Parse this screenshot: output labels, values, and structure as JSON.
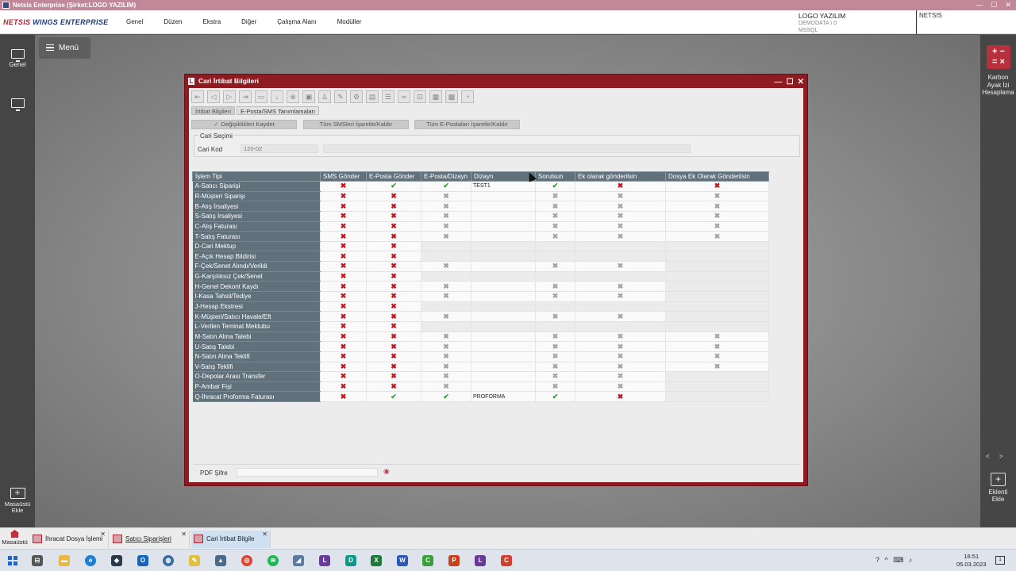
{
  "titlebar": {
    "title": "Netsis Enterprise (Şirket:LOGO YAZILIM)",
    "min": "—",
    "max": "☐",
    "close": "✕"
  },
  "menubar": {
    "logo_prefix": "NETSIS",
    "logo_suffix": " WINGS ENTERPRISE",
    "items": [
      "Genel",
      "Düzen",
      "Ekstra",
      "Diğer",
      "Çalışma Alanı",
      "Modüller"
    ],
    "company": "LOGO YAZILIM",
    "db": "DEMODATA \\ 0",
    "dbtype": "MSSQL",
    "user": "NETSIS"
  },
  "leftbar": {
    "genel_label": "Genel",
    "add_desktop_label_1": "Masaüstü",
    "add_desktop_label_2": "Ekle"
  },
  "menu_button": "Menü",
  "rightbar": {
    "karbon_symbols_top": "+ −",
    "karbon_symbols_bottom": "= ×",
    "karbon_label_1": "Karbon",
    "karbon_label_2": "Ayak İzi",
    "karbon_label_3": "Hesaplama",
    "nav": "< >",
    "eklenti_label_1": "Eklenti",
    "eklenti_label_2": "Ekle"
  },
  "window": {
    "title": "Cari İrtibat Bilgileri",
    "tabs": [
      "İrtibat Bilgileri",
      "E-Posta/SMS Tanımlamaları"
    ],
    "actions": {
      "save": "Değişiklikleri Kaydet",
      "toggle_sms": "Tüm SMSleri İşaretle/Kaldır",
      "toggle_email": "Tüm E-Postaları İşaretle/Kaldır"
    },
    "cari_group_title": "Cari Seçimi",
    "cari_kod_label": "Cari Kod",
    "cari_kod_value": "120-02",
    "pdf_label": "PDF Şifre"
  },
  "table": {
    "columns": [
      "İşlem Tipi",
      "SMS Gönder",
      "E-Posta Gönder",
      "E-Posta/Dizayn",
      "Dizayn",
      "Sorulsun",
      "Ek olarak gönderilsin",
      "Dosya Ek Olarak Gönderilsin"
    ],
    "rows": [
      {
        "name": "A-Satıcı Siparişi",
        "cells": [
          "x",
          "ok",
          "ok",
          "TEST1",
          "ok",
          "x",
          "x"
        ]
      },
      {
        "name": "R-Müşteri Siparişi",
        "cells": [
          "x",
          "x",
          "g",
          "",
          "g",
          "g",
          "g"
        ]
      },
      {
        "name": "B-Alış İrsaliyesi",
        "cells": [
          "x",
          "x",
          "g",
          "",
          "g",
          "g",
          "g"
        ]
      },
      {
        "name": "S-Satış İrsaliyesi",
        "cells": [
          "x",
          "x",
          "g",
          "",
          "g",
          "g",
          "g"
        ]
      },
      {
        "name": "C-Alış Faturası",
        "cells": [
          "x",
          "x",
          "g",
          "",
          "g",
          "g",
          "g"
        ]
      },
      {
        "name": "T-Satış Faturası",
        "cells": [
          "x",
          "x",
          "g",
          "",
          "g",
          "g",
          "g"
        ]
      },
      {
        "name": "D-Cari Mektup",
        "cells": [
          "x",
          "x",
          "-",
          "-",
          "-",
          "-",
          "-"
        ]
      },
      {
        "name": "E-Açık Hesap Bildirisi",
        "cells": [
          "x",
          "x",
          "-",
          "-",
          "-",
          "-",
          "-"
        ]
      },
      {
        "name": "F-Çek/Senet Alındı/Verildi",
        "cells": [
          "x",
          "x",
          "g",
          "",
          "g",
          "g",
          "-"
        ]
      },
      {
        "name": "G-Karşılıksız Çek/Senet",
        "cells": [
          "x",
          "x",
          "-",
          "-",
          "-",
          "-",
          "-"
        ]
      },
      {
        "name": "H-Genel Dekont Kaydı",
        "cells": [
          "x",
          "x",
          "g",
          "",
          "g",
          "g",
          "-"
        ]
      },
      {
        "name": "I-Kasa Tahsil/Tediye",
        "cells": [
          "x",
          "x",
          "g",
          "",
          "g",
          "g",
          "-"
        ]
      },
      {
        "name": "J-Hesap Ekstresi",
        "cells": [
          "x",
          "x",
          "-",
          "-",
          "-",
          "-",
          "-"
        ]
      },
      {
        "name": "K-Müşteri/Satıcı Havale/Eft",
        "cells": [
          "x",
          "x",
          "g",
          "",
          "g",
          "g",
          "-"
        ]
      },
      {
        "name": "L-Verilen Teminat Mektubu",
        "cells": [
          "x",
          "x",
          "-",
          "-",
          "-",
          "-",
          "-"
        ]
      },
      {
        "name": "M-Satın Alma Talebi",
        "cells": [
          "x",
          "x",
          "g",
          "",
          "g",
          "g",
          "g"
        ]
      },
      {
        "name": "U-Satış Talebi",
        "cells": [
          "x",
          "x",
          "g",
          "",
          "g",
          "g",
          "g"
        ]
      },
      {
        "name": "N-Satın Alma Teklifi",
        "cells": [
          "x",
          "x",
          "g",
          "",
          "g",
          "g",
          "g"
        ]
      },
      {
        "name": "V-Satış Teklifi",
        "cells": [
          "x",
          "x",
          "g",
          "",
          "g",
          "g",
          "g"
        ]
      },
      {
        "name": "O-Depolar Arası Transfer",
        "cells": [
          "x",
          "x",
          "g",
          "",
          "g",
          "g",
          "-"
        ]
      },
      {
        "name": "P-Ambar Fişi",
        "cells": [
          "x",
          "x",
          "g",
          "",
          "g",
          "g",
          "-"
        ]
      },
      {
        "name": "Q-İhracat Proforma Faturası",
        "cells": [
          "x",
          "ok",
          "ok",
          "PROFORMA",
          "ok",
          "x",
          "-"
        ]
      }
    ]
  },
  "wintabs": {
    "home_label": "Masaüstü",
    "tabs": [
      {
        "label": "İhracat Dosya İşlemi",
        "active": false
      },
      {
        "label": "Satıcı Siparişleri",
        "active": false
      },
      {
        "label": "Cari İrtibat Bilgile",
        "active": true
      }
    ],
    "close": "✕"
  },
  "taskbar": {
    "time": "16:51",
    "date": "05.03.2023",
    "tray": "? ^ ⌨ ♪"
  },
  "colors": {
    "window_frame": "#8f1b22",
    "grid_header": "#60717c",
    "check_green": "#2aa02a",
    "x_red": "#c4141c"
  }
}
